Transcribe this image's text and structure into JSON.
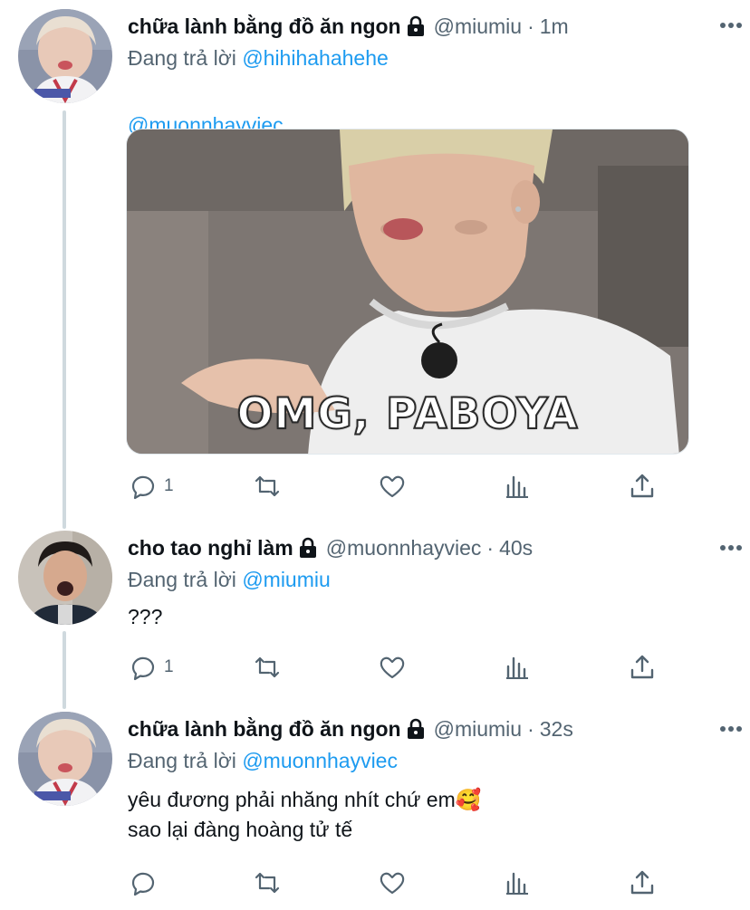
{
  "tweets": [
    {
      "display_name": "chữa lành bằng đồ ăn ngon",
      "handle": "@miumiu",
      "time": "1m",
      "reply_prefix": "Đang trả lời",
      "reply_to": "@hihihahahehe",
      "body_mention": "@muonnhayviec",
      "media": {
        "caption": "OMG, PABOYA"
      },
      "reply_count": "1",
      "icons": [
        "reply-icon",
        "retweet-icon",
        "like-icon",
        "analytics-icon",
        "share-icon"
      ]
    },
    {
      "display_name": "cho tao nghỉ làm",
      "handle": "@muonnhayviec",
      "time": "40s",
      "reply_prefix": "Đang trả lời",
      "reply_to": "@miumiu",
      "body": "???",
      "reply_count": "1"
    },
    {
      "display_name": "chữa lành bằng đồ ăn ngon",
      "handle": "@miumiu",
      "time": "32s",
      "reply_prefix": "Đang trả lời",
      "reply_to": "@muonnhayviec",
      "body": "yêu đương phải nhăng nhít chứ em🥰\n sao lại đàng hoàng tử tế",
      "reply_count": ""
    }
  ],
  "separator": "·",
  "colors": {
    "link": "#1d9bf0",
    "secondary": "#536471",
    "thread_line": "#cfd9de"
  }
}
